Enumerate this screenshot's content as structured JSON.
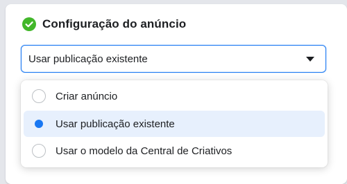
{
  "section": {
    "title": "Configuração do anúncio",
    "status_icon": "check-circle-icon",
    "status_color": "#42b72a"
  },
  "select": {
    "value": "Usar publicação existente",
    "accent_color": "#1877f2"
  },
  "options": [
    {
      "label": "Criar anúncio",
      "selected": false
    },
    {
      "label": "Usar publicação existente",
      "selected": true
    },
    {
      "label": "Usar o modelo da Central de Criativos",
      "selected": false
    }
  ]
}
